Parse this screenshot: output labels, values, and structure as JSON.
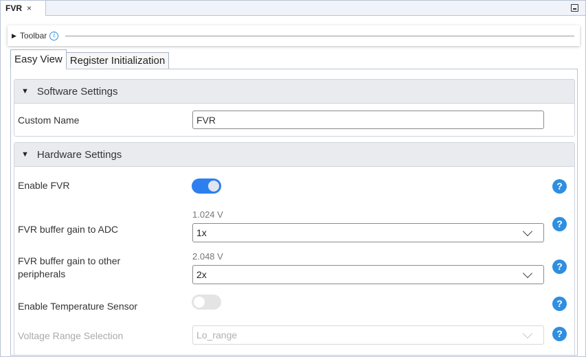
{
  "editor_tab": {
    "title": "FVR",
    "close": "×"
  },
  "toolbar": {
    "label": "Toolbar",
    "info": "i"
  },
  "view_tabs": {
    "easy_view": "Easy View",
    "register_init": "Register Initialization"
  },
  "software_settings": {
    "header": "Software Settings",
    "custom_name_label": "Custom Name",
    "custom_name_value": "FVR"
  },
  "hardware_settings": {
    "header": "Hardware Settings",
    "enable_fvr_label": "Enable FVR",
    "enable_fvr": true,
    "adc_gain_label": "FVR buffer gain to ADC",
    "adc_gain_hint": "1.024 V",
    "adc_gain_value": "1x",
    "periph_gain_label_line1": "FVR buffer gain to other",
    "periph_gain_label_line2": "peripherals",
    "periph_gain_hint": "2.048 V",
    "periph_gain_value": "2x",
    "temp_sensor_label": "Enable Temperature Sensor",
    "temp_sensor": false,
    "voltage_range_label": "Voltage Range Selection",
    "voltage_range_value": "Lo_range"
  },
  "help_glyph": "?",
  "colors": {
    "accent": "#2d7ff0",
    "help": "#2f8ee0",
    "section_header_bg": "#e9ebee"
  }
}
